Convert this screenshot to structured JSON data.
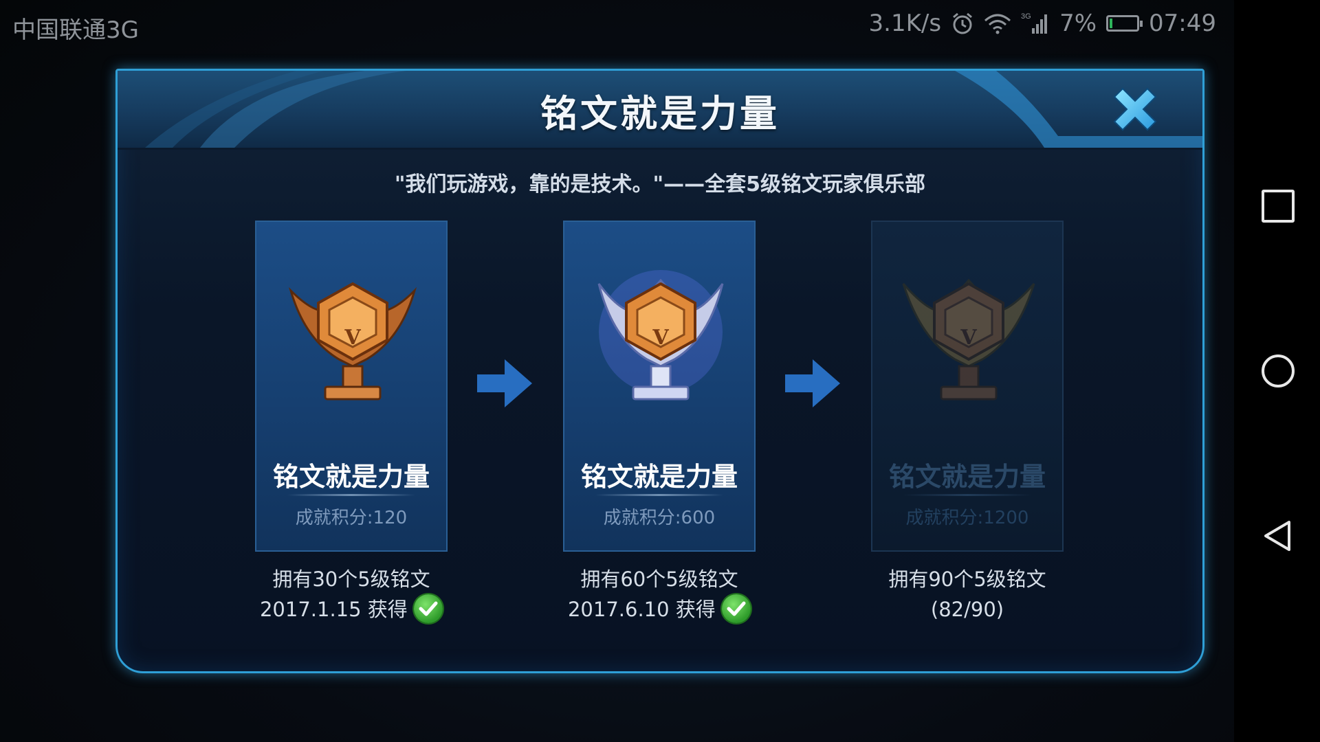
{
  "status_bar": {
    "carrier": "中国联通3G",
    "net_speed": "3.1K/s",
    "signal_tag": "3G",
    "battery": "7%",
    "time": "07:49",
    "icons": [
      "alarm-icon",
      "wifi-icon",
      "signal-icon",
      "battery-icon"
    ]
  },
  "dialog": {
    "title": "铭文就是力量",
    "subtitle": "\"我们玩游戏，靠的是技术。\"——全套5级铭文玩家俱乐部"
  },
  "tiers": [
    {
      "title": "铭文就是力量",
      "score": "成就积分:120",
      "requirement": "拥有30个5级铭文",
      "status": "2017.1.15 获得",
      "completed": true,
      "badge": "bronze-badge-icon"
    },
    {
      "title": "铭文就是力量",
      "score": "成就积分:600",
      "requirement": "拥有60个5级铭文",
      "status": "2017.6.10 获得",
      "completed": true,
      "badge": "silver-badge-icon"
    },
    {
      "title": "铭文就是力量",
      "score": "成就积分:1200",
      "requirement": "拥有90个5级铭文",
      "status": "(82/90)",
      "completed": false,
      "progress": 0.911,
      "badge": "gold-badge-icon"
    }
  ],
  "colors": {
    "accent": "#2f9fd6",
    "card_active": "#1c4d86",
    "check": "#2e9b2a"
  }
}
